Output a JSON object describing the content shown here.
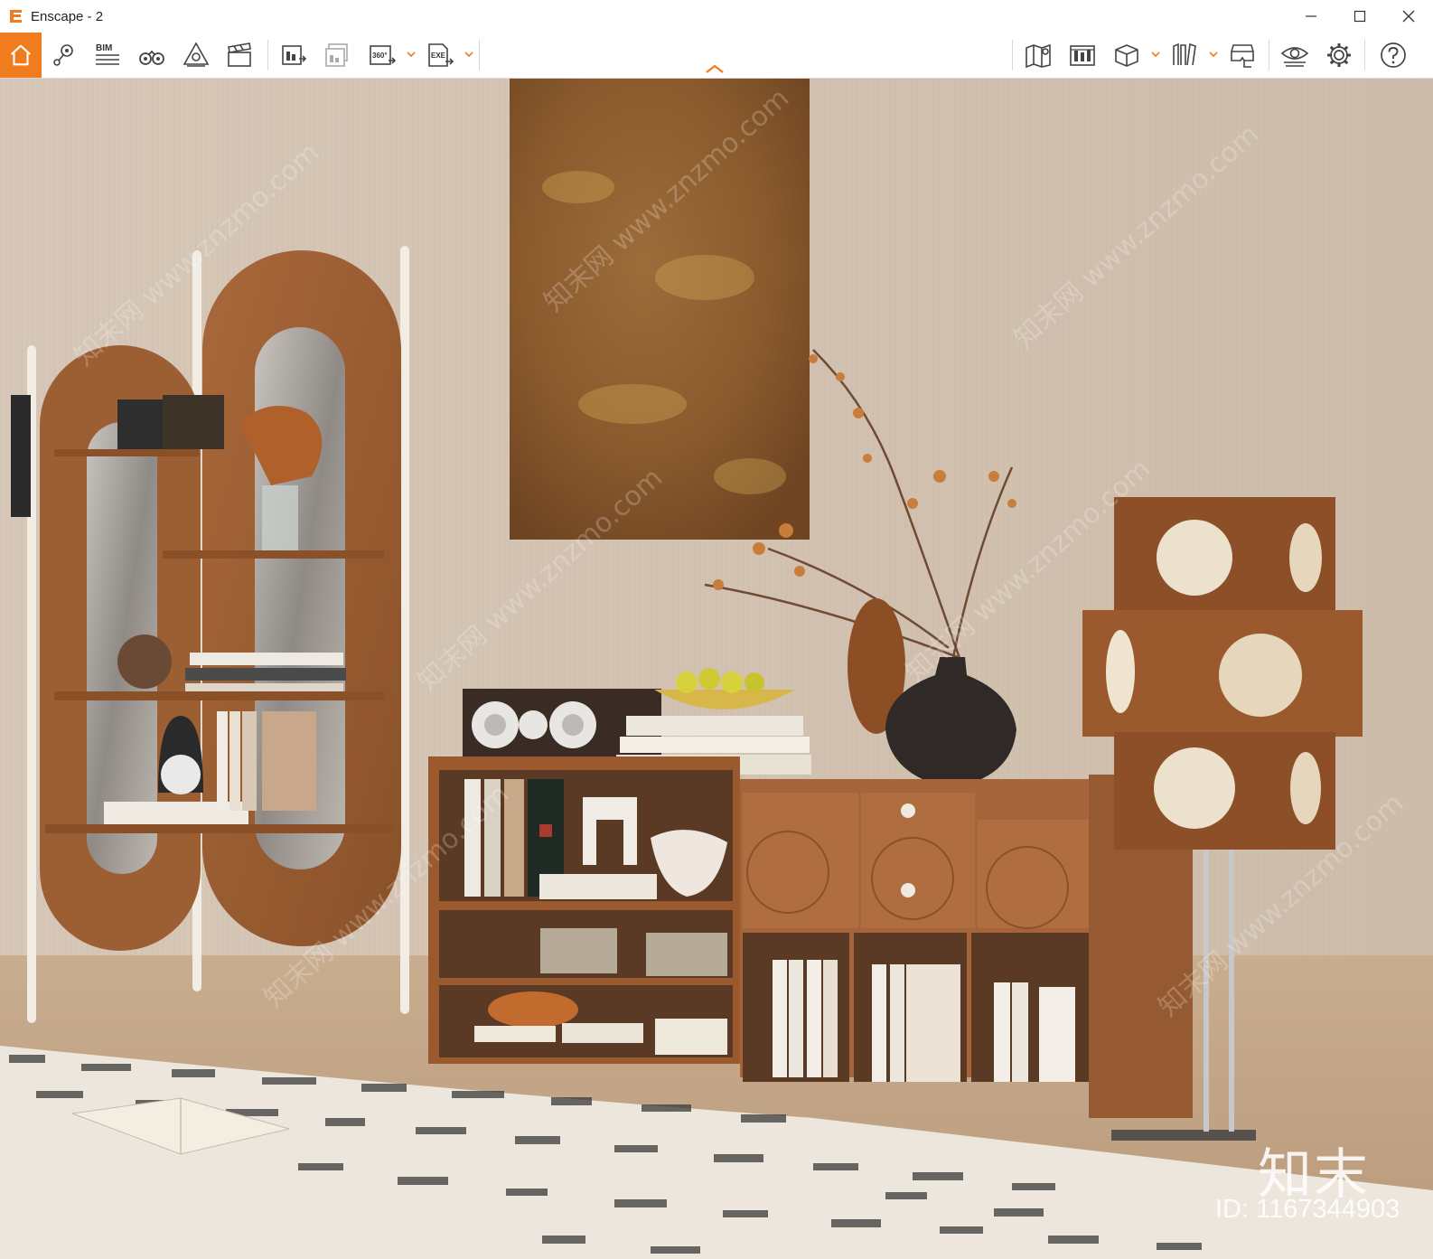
{
  "window": {
    "title": "Enscape - 2",
    "controls": [
      "minimize-icon",
      "maximize-icon",
      "close-icon"
    ]
  },
  "toolbar": {
    "accent_color": "#f07c1e",
    "left_tools": [
      {
        "name": "home-icon",
        "label": ""
      },
      {
        "name": "geo-location-icon",
        "label": ""
      },
      {
        "name": "bim-icon",
        "label": "BIM"
      },
      {
        "name": "binoculars-icon",
        "label": ""
      },
      {
        "name": "asset-library-icon",
        "label": ""
      },
      {
        "name": "video-editor-icon",
        "label": ""
      },
      {
        "name": "screenshot-icon",
        "label": ""
      },
      {
        "name": "batch-render-icon",
        "label": ""
      },
      {
        "name": "panorama-360-icon",
        "label": "360°"
      },
      {
        "name": "exe-export-icon",
        "label": "EXE"
      }
    ],
    "right_tools": [
      {
        "name": "map-view-icon"
      },
      {
        "name": "visual-settings-icon"
      },
      {
        "name": "cube-view-icon"
      },
      {
        "name": "library-books-icon"
      },
      {
        "name": "vr-headset-icon"
      },
      {
        "name": "eye-visibility-icon"
      },
      {
        "name": "settings-gear-icon"
      },
      {
        "name": "help-icon"
      }
    ]
  },
  "viewport": {
    "watermark_brand": "知末",
    "watermark_id": "ID: 1167344903",
    "diagonal_watermark": "知末网 www.znzmo.com"
  }
}
